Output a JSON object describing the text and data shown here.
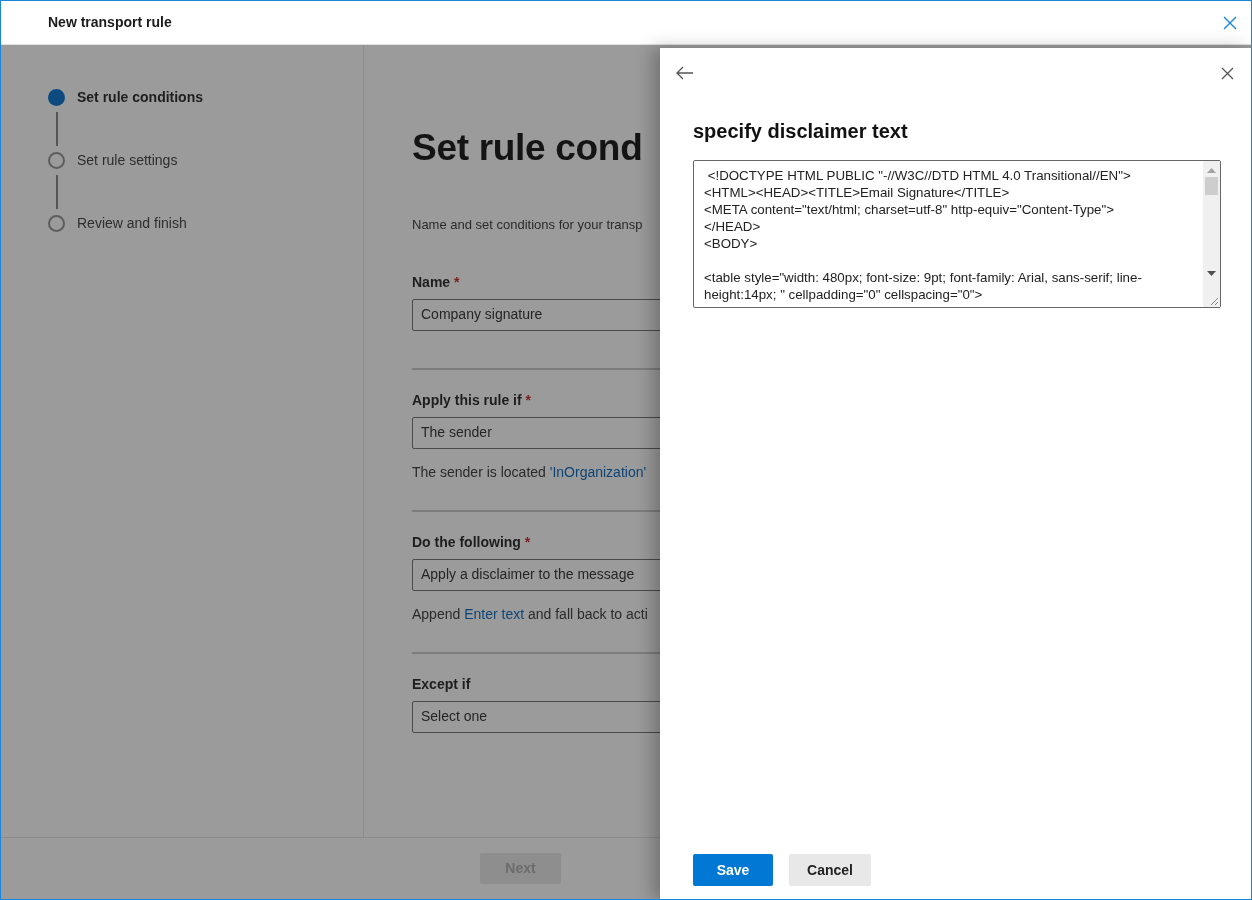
{
  "window": {
    "title": "New transport rule"
  },
  "steps": [
    {
      "label": "Set rule conditions",
      "selected": true
    },
    {
      "label": "Set rule settings",
      "selected": false
    },
    {
      "label": "Review and finish",
      "selected": false
    }
  ],
  "main": {
    "heading": "Set rule cond",
    "description": "Name and set conditions for your transp",
    "sections": [
      {
        "fields": [
          {
            "label": "Name",
            "required_mark": "*",
            "value": "Company signature"
          }
        ]
      },
      {
        "fields": [
          {
            "label": "Apply this rule if",
            "required_mark": "*",
            "value": "The sender",
            "detail": [
              {
                "kind": "text",
                "text": "The sender is located "
              },
              {
                "kind": "link",
                "text": "'InOrganization'"
              }
            ]
          }
        ]
      },
      {
        "fields": [
          {
            "label": "Do the following",
            "required_mark": "*",
            "value": "Apply a disclaimer to the message",
            "detail": [
              {
                "kind": "text",
                "text": "Append "
              },
              {
                "kind": "link",
                "text": "Enter text"
              },
              {
                "kind": "text",
                "text": " and fall back to acti"
              }
            ]
          }
        ]
      },
      {
        "fields": [
          {
            "label": "Except if",
            "value": "Select one"
          }
        ]
      }
    ],
    "next_button": {
      "label": "Next",
      "disabled": true
    }
  },
  "panel": {
    "title": "specify disclaimer text",
    "text_paragraphs": [
      [
        " <!DOCTYPE HTML PUBLIC \"-//W3C//DTD HTML 4.0 Transitional//EN\">",
        "<HTML><HEAD><TITLE>Email Signature</TITLE>",
        "<META content=\"text/html; charset=utf-8\" http-equiv=\"Content-Type\">",
        "</HEAD>",
        "<BODY>"
      ],
      [
        "<table style=\"width: 480px; font-size: 9pt; font-family: Arial, sans-serif; line-",
        "height:14px; \" cellpadding=\"0\" cellspacing=\"0\">"
      ]
    ],
    "buttons": [
      {
        "label": "Save",
        "kind": "primary"
      },
      {
        "label": "Cancel",
        "kind": "secondary"
      }
    ]
  }
}
